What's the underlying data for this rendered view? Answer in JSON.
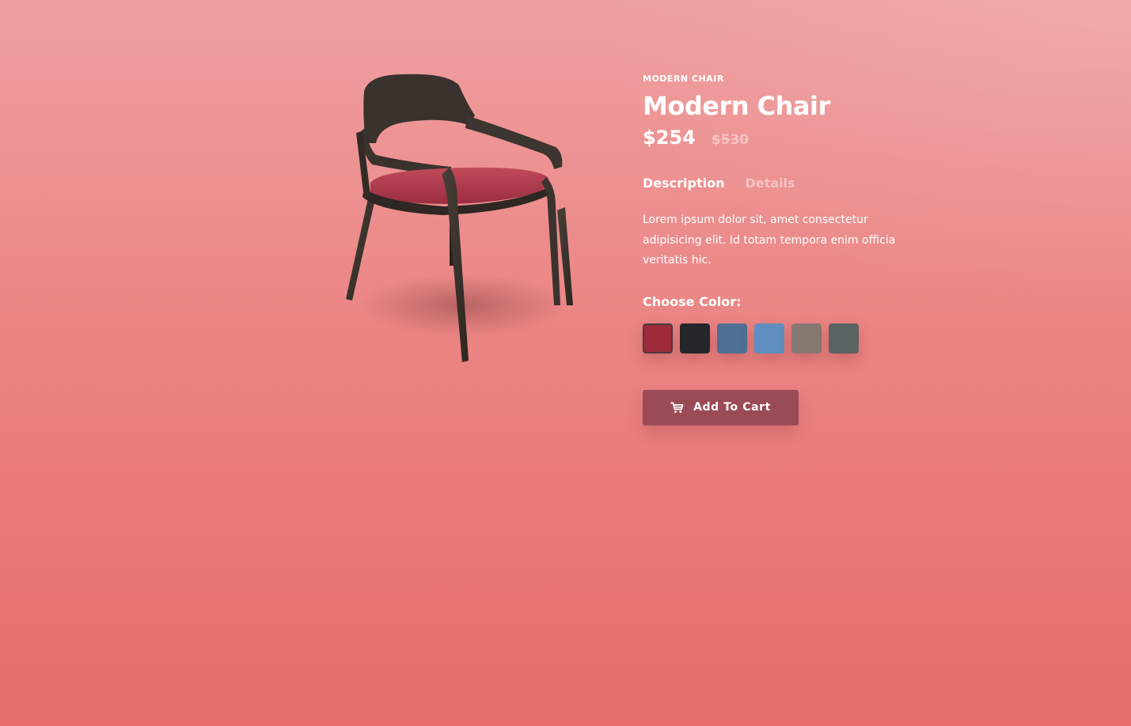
{
  "product": {
    "category": "MODERN CHAIR",
    "title": "Modern Chair",
    "price_current": "$254",
    "price_old": "$530",
    "image_icon": "chair-image"
  },
  "tabs": [
    {
      "label": "Description",
      "active": true
    },
    {
      "label": "Details",
      "active": false
    }
  ],
  "description": "Lorem ipsum dolor sit, amet consectetur adipisicing elit. Id totam tempora enim officia veritatis hic.",
  "color_picker": {
    "label": "Choose Color:",
    "swatches": [
      {
        "color": "#9e2a3a",
        "selected": true
      },
      {
        "color": "#26272a",
        "selected": false
      },
      {
        "color": "#4f6f95",
        "selected": false
      },
      {
        "color": "#5f8fc0",
        "selected": false
      },
      {
        "color": "#877872",
        "selected": false
      },
      {
        "color": "#5a6262",
        "selected": false
      }
    ]
  },
  "cart_button": {
    "label": "Add To Cart",
    "icon": "cart-icon"
  },
  "colors": {
    "background_top": "#ef9fa0",
    "background_bottom": "#e66d6b",
    "button": "#9b4b55",
    "text": "#ffffff",
    "muted": "#f5c3c3"
  }
}
